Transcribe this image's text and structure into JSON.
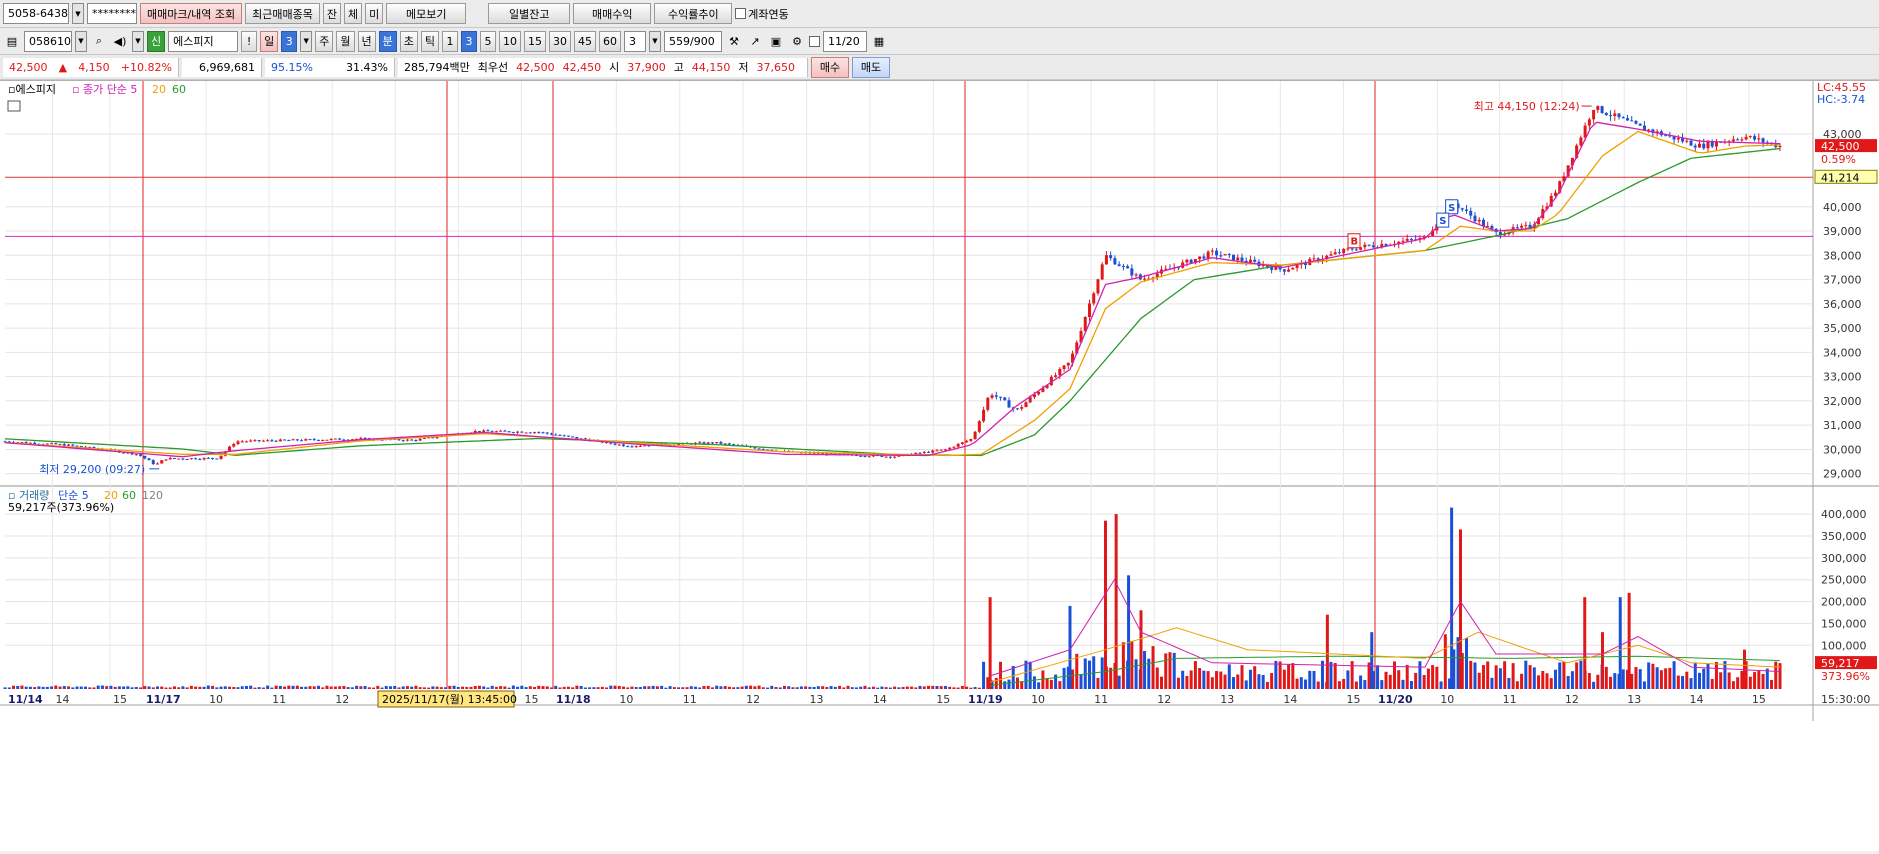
{
  "toolbar1": {
    "account": "5058-6438",
    "password": "********",
    "buttons": [
      "매매마크/내역 조회",
      "최근매매종목",
      "잔",
      "체",
      "미",
      "메모보기",
      "일별잔고",
      "매매수익",
      "수익률추이"
    ],
    "checkbox_label": "계좌연동"
  },
  "toolbar2": {
    "stock_code": "058610",
    "stock_badge": "신",
    "stock_name": "에스피지",
    "exclaim": "!",
    "period_daily": "일",
    "period_n": "3",
    "periods": [
      "주",
      "월",
      "년"
    ],
    "minute": "분",
    "second": "초",
    "tick": "틱",
    "intervals": [
      "1",
      "3",
      "5",
      "10",
      "15",
      "30",
      "45",
      "60"
    ],
    "count_select": "3",
    "data_count": "559",
    "data_total": "/900",
    "date_field": "11/20"
  },
  "quote": {
    "price": "42,500",
    "arrow": "▲",
    "change": "4,150",
    "change_pct": "+10.82%",
    "volume": "6,969,681",
    "vol_ratio": "95.15%",
    "turnover": "31.43%",
    "trade_value": "285,794백만",
    "best_label": "최우선",
    "ask": "42,500",
    "bid": "42,450",
    "open_label": "시",
    "open": "37,900",
    "high_label": "고",
    "high": "44,150",
    "low_label": "저",
    "low": "37,650",
    "buy": "매수",
    "sell": "매도"
  },
  "colors": {
    "up": "#e01818",
    "down": "#1a4fd8",
    "ma5": "#d020b0",
    "ma20": "#f0a000",
    "ma60": "#2a9a2a",
    "ma120": "#808080",
    "hline_red": "#e03030",
    "hline_magenta": "#e020d0"
  },
  "chart_data": [
    {
      "type": "candlestick",
      "legend": {
        "name": "에스피지",
        "ma_label": "종가 단순",
        "ma_periods": [
          "5",
          "20",
          "60"
        ]
      },
      "x_sessions": [
        {
          "date": "11/14",
          "hour_ticks": [
            "14",
            "15"
          ]
        },
        {
          "date": "11/17",
          "hour_ticks": [
            "10",
            "11",
            "12",
            "13",
            "14",
            "15"
          ]
        },
        {
          "date": "11/18",
          "hour_ticks": [
            "10",
            "11",
            "12",
            "13",
            "14",
            "15"
          ]
        },
        {
          "date": "11/19",
          "hour_ticks": [
            "10",
            "11",
            "12",
            "13",
            "14",
            "15"
          ]
        },
        {
          "date": "11/20",
          "hour_ticks": [
            "10",
            "11",
            "12",
            "13",
            "14",
            "15"
          ]
        }
      ],
      "cursor_label": "2025/11/17(월) 13:45:00",
      "time_label": "15:30:00",
      "y_ticks": [
        "29,000",
        "30,000",
        "31,000",
        "32,000",
        "33,000",
        "34,000",
        "35,000",
        "36,000",
        "37,000",
        "38,000",
        "39,000",
        "40,000",
        "43,000"
      ],
      "ylim": [
        28700,
        45100
      ],
      "lc_label": "LC:45.55",
      "hc_label": "HC:-3.74",
      "current_price_label": "42,500",
      "current_pct_label": "0.59%",
      "hline_price_label": "41,214",
      "hline_red": 41214,
      "hline_magenta": 38780,
      "high_annotation": "최고 44,150 (12:24)",
      "low_annotation": "최저 29,200 (09:27)",
      "trade_marks": [
        "S",
        "S",
        "B"
      ],
      "price_path": [
        [
          0,
          30330
        ],
        [
          0.035,
          30180
        ],
        [
          0.06,
          29960
        ],
        [
          0.075,
          29800
        ],
        [
          0.085,
          29360
        ],
        [
          0.09,
          29620
        ],
        [
          0.12,
          29640
        ],
        [
          0.13,
          30330
        ],
        [
          0.16,
          30380
        ],
        [
          0.2,
          30440
        ],
        [
          0.23,
          30380
        ],
        [
          0.265,
          30750
        ],
        [
          0.3,
          30720
        ],
        [
          0.35,
          30150
        ],
        [
          0.4,
          30280
        ],
        [
          0.44,
          29900
        ],
        [
          0.5,
          29700
        ],
        [
          0.53,
          30000
        ],
        [
          0.545,
          30450
        ],
        [
          0.555,
          32350
        ],
        [
          0.57,
          31600
        ],
        [
          0.6,
          33600
        ],
        [
          0.62,
          38000
        ],
        [
          0.64,
          37000
        ],
        [
          0.68,
          38100
        ],
        [
          0.72,
          37400
        ],
        [
          0.76,
          38300
        ],
        [
          0.8,
          38700
        ],
        [
          0.815,
          40200
        ],
        [
          0.84,
          38900
        ],
        [
          0.86,
          39200
        ],
        [
          0.875,
          40800
        ],
        [
          0.895,
          44100
        ],
        [
          0.92,
          43300
        ],
        [
          0.955,
          42500
        ],
        [
          0.98,
          42900
        ],
        [
          1.0,
          42500
        ]
      ],
      "ma5_path": [
        [
          0,
          30280
        ],
        [
          0.1,
          29700
        ],
        [
          0.13,
          29950
        ],
        [
          0.2,
          30400
        ],
        [
          0.27,
          30700
        ],
        [
          0.35,
          30250
        ],
        [
          0.44,
          29800
        ],
        [
          0.52,
          29750
        ],
        [
          0.545,
          30200
        ],
        [
          0.57,
          31800
        ],
        [
          0.6,
          33300
        ],
        [
          0.62,
          36800
        ],
        [
          0.64,
          37100
        ],
        [
          0.68,
          37900
        ],
        [
          0.72,
          37500
        ],
        [
          0.76,
          38100
        ],
        [
          0.8,
          38700
        ],
        [
          0.815,
          39700
        ],
        [
          0.84,
          39000
        ],
        [
          0.86,
          39100
        ],
        [
          0.875,
          40500
        ],
        [
          0.895,
          43500
        ],
        [
          0.92,
          43200
        ],
        [
          0.955,
          42700
        ],
        [
          1.0,
          42600
        ]
      ],
      "ma20_path": [
        [
          0,
          30280
        ],
        [
          0.1,
          29800
        ],
        [
          0.13,
          29800
        ],
        [
          0.2,
          30350
        ],
        [
          0.27,
          30650
        ],
        [
          0.35,
          30300
        ],
        [
          0.44,
          29900
        ],
        [
          0.53,
          29750
        ],
        [
          0.55,
          29800
        ],
        [
          0.58,
          31200
        ],
        [
          0.6,
          32500
        ],
        [
          0.62,
          35800
        ],
        [
          0.64,
          36900
        ],
        [
          0.68,
          37700
        ],
        [
          0.72,
          37600
        ],
        [
          0.76,
          37900
        ],
        [
          0.8,
          38200
        ],
        [
          0.82,
          39200
        ],
        [
          0.84,
          39000
        ],
        [
          0.86,
          39000
        ],
        [
          0.875,
          39700
        ],
        [
          0.9,
          42100
        ],
        [
          0.92,
          43100
        ],
        [
          0.955,
          42200
        ],
        [
          0.98,
          42500
        ],
        [
          1.0,
          42550
        ]
      ],
      "ma60_path": [
        [
          0,
          30440
        ],
        [
          0.1,
          30020
        ],
        [
          0.13,
          29760
        ],
        [
          0.2,
          30150
        ],
        [
          0.3,
          30450
        ],
        [
          0.4,
          30200
        ],
        [
          0.5,
          29800
        ],
        [
          0.55,
          29750
        ],
        [
          0.58,
          30600
        ],
        [
          0.6,
          32000
        ],
        [
          0.64,
          35400
        ],
        [
          0.67,
          37000
        ],
        [
          0.72,
          37600
        ],
        [
          0.76,
          37900
        ],
        [
          0.8,
          38200
        ],
        [
          0.84,
          38800
        ],
        [
          0.88,
          39500
        ],
        [
          0.92,
          41000
        ],
        [
          0.95,
          42000
        ],
        [
          1.0,
          42400
        ]
      ]
    },
    {
      "type": "bar",
      "legend": {
        "name": "거래량",
        "ma_label": "단순",
        "ma_periods": [
          "5",
          "20",
          "60",
          "120"
        ]
      },
      "info_label": "59,217주(373.96%)",
      "y_ticks": [
        "100,000",
        "150,000",
        "200,000",
        "250,000",
        "300,000",
        "350,000",
        "400,000"
      ],
      "ylim": [
        0,
        430000
      ],
      "current_label": "59,217",
      "current_pct_label": "373.96%",
      "spikes": [
        [
          0.555,
          210000
        ],
        [
          0.6,
          190000
        ],
        [
          0.62,
          385000
        ],
        [
          0.626,
          400000
        ],
        [
          0.633,
          260000
        ],
        [
          0.64,
          180000
        ],
        [
          0.745,
          170000
        ],
        [
          0.815,
          415000
        ],
        [
          0.82,
          365000
        ],
        [
          0.89,
          210000
        ],
        [
          0.91,
          210000
        ],
        [
          0.915,
          220000
        ],
        [
          0.9,
          130000
        ],
        [
          0.77,
          130000
        ],
        [
          0.98,
          90000
        ],
        [
          1.0,
          59217
        ]
      ],
      "ma5_path": [
        [
          0.555,
          30000
        ],
        [
          0.6,
          90000
        ],
        [
          0.625,
          250000
        ],
        [
          0.64,
          130000
        ],
        [
          0.68,
          60000
        ],
        [
          0.8,
          50000
        ],
        [
          0.82,
          200000
        ],
        [
          0.84,
          80000
        ],
        [
          0.9,
          80000
        ],
        [
          0.92,
          120000
        ],
        [
          0.95,
          50000
        ],
        [
          1.0,
          40000
        ]
      ],
      "ma20_path": [
        [
          0.555,
          15000
        ],
        [
          0.62,
          90000
        ],
        [
          0.66,
          140000
        ],
        [
          0.7,
          90000
        ],
        [
          0.8,
          70000
        ],
        [
          0.83,
          130000
        ],
        [
          0.88,
          60000
        ],
        [
          0.92,
          100000
        ],
        [
          0.95,
          60000
        ],
        [
          1.0,
          50000
        ]
      ],
      "ma60_path": [
        [
          0.555,
          8000
        ],
        [
          0.62,
          40000
        ],
        [
          0.66,
          70000
        ],
        [
          0.75,
          75000
        ],
        [
          0.85,
          70000
        ],
        [
          0.92,
          75000
        ],
        [
          1.0,
          65000
        ]
      ]
    }
  ]
}
